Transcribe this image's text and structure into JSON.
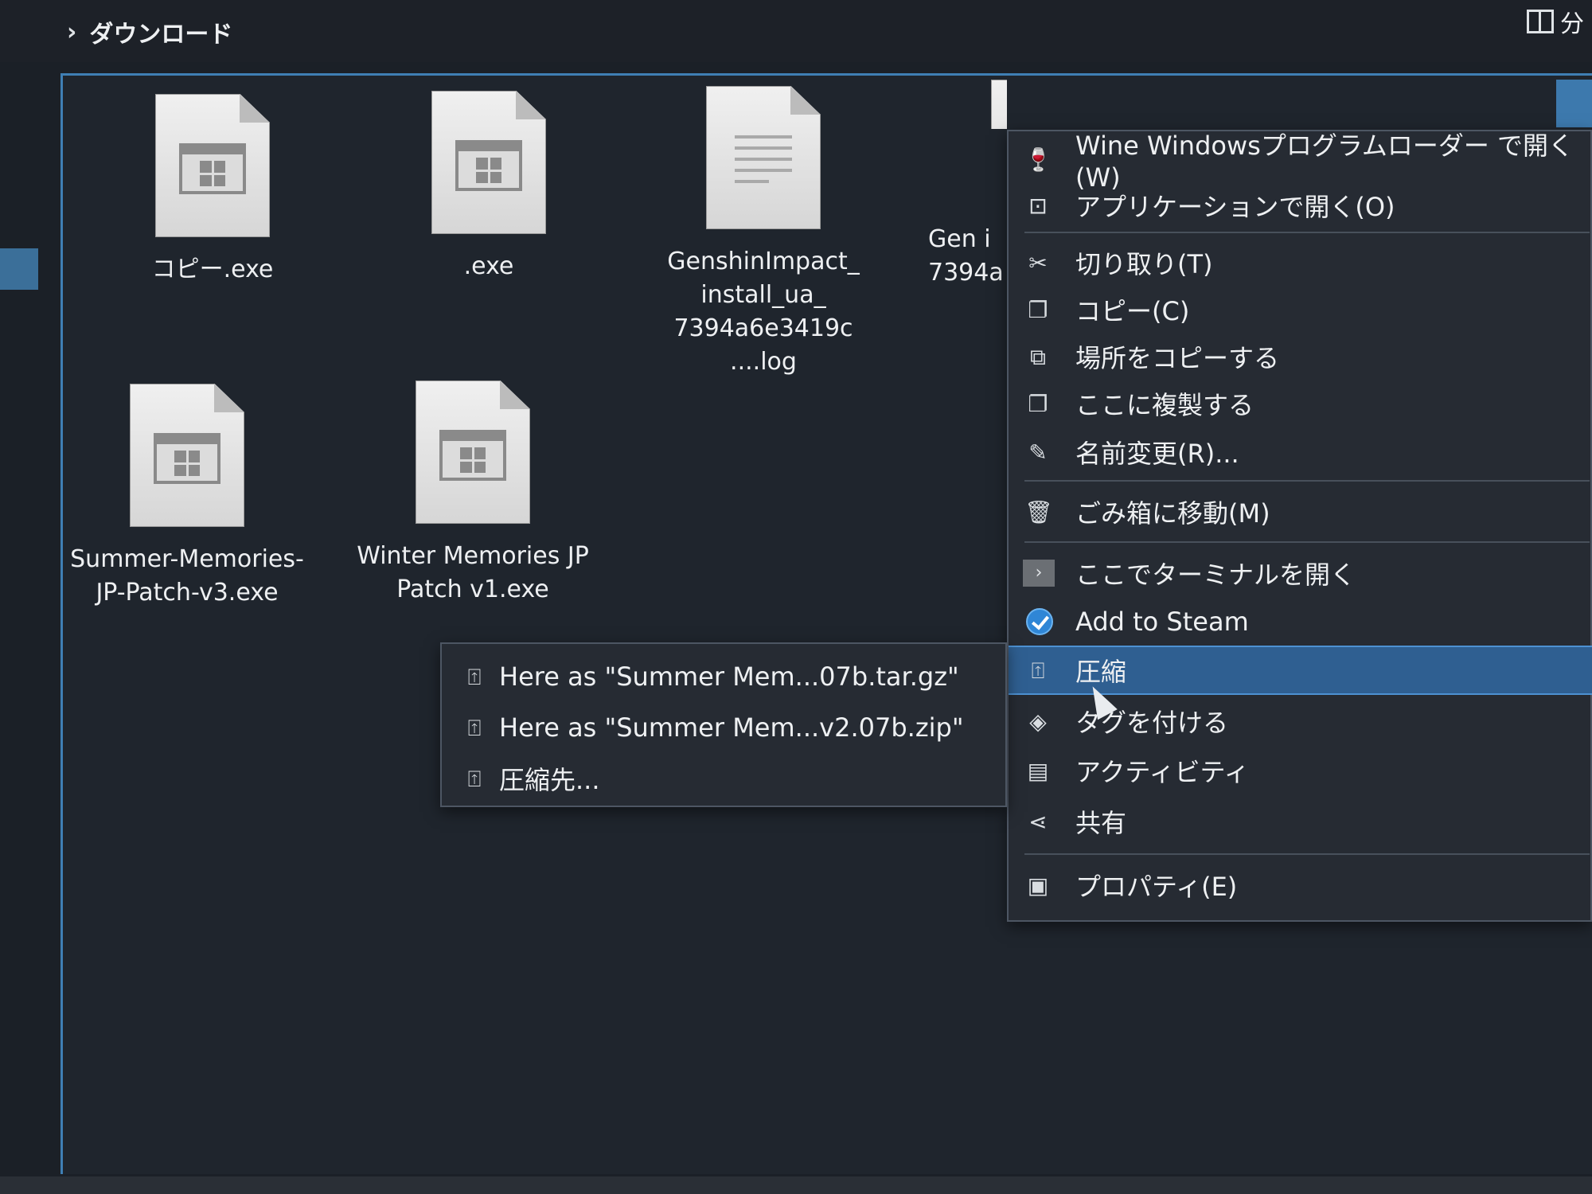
{
  "breadcrumb": {
    "chevron": "›",
    "current": "ダウンロード"
  },
  "header": {
    "split_label": "分"
  },
  "files": [
    {
      "name": "コピー.exe",
      "type": "exe"
    },
    {
      "name": ".exe",
      "type": "exe"
    },
    {
      "name": "GenshinImpact_ install_ua_ 7394a6e3419c ....log",
      "type": "log"
    },
    {
      "name": "Gen i 7394a",
      "type": "partial"
    },
    {
      "name": "Summer-Memories-JP-Patch-v3.exe",
      "type": "exe"
    },
    {
      "name": "Winter Memories JP Patch v1.exe",
      "type": "exe"
    }
  ],
  "context_menu": {
    "items": [
      {
        "label": "Wine Windowsプログラムローダー で開く(W)",
        "icon": "wine-icon"
      },
      {
        "label": "アプリケーションで開く(O)",
        "icon": "open-with-icon"
      },
      {
        "label": "切り取り(T)",
        "icon": "cut-icon"
      },
      {
        "label": "コピー(C)",
        "icon": "copy-icon"
      },
      {
        "label": "場所をコピーする",
        "icon": "copy-location-icon"
      },
      {
        "label": "ここに複製する",
        "icon": "duplicate-icon"
      },
      {
        "label": "名前変更(R)...",
        "icon": "rename-icon"
      },
      {
        "label": "ごみ箱に移動(M)",
        "icon": "trash-icon"
      },
      {
        "label": "ここでターミナルを開く",
        "icon": "terminal-icon"
      },
      {
        "label": "Add to Steam",
        "icon": "steam-icon"
      },
      {
        "label": "圧縮",
        "icon": "archive-icon",
        "active": true
      },
      {
        "label": "タグを付ける",
        "icon": "tag-icon"
      },
      {
        "label": "アクティビティ",
        "icon": "activity-icon"
      },
      {
        "label": "共有",
        "icon": "share-icon"
      },
      {
        "label": "プロパティ(E)",
        "icon": "properties-icon"
      }
    ]
  },
  "submenu": {
    "items": [
      {
        "label": "Here as \"Summer Mem...07b.tar.gz\"",
        "icon": "archive-icon"
      },
      {
        "label": "Here as \"Summer Mem...v2.07b.zip\"",
        "icon": "archive-icon"
      },
      {
        "label": "圧縮先...",
        "icon": "archive-icon"
      }
    ]
  },
  "colors": {
    "highlight": "#2f5f91",
    "accent": "#3f7fb4",
    "menu_bg": "#262b33"
  }
}
